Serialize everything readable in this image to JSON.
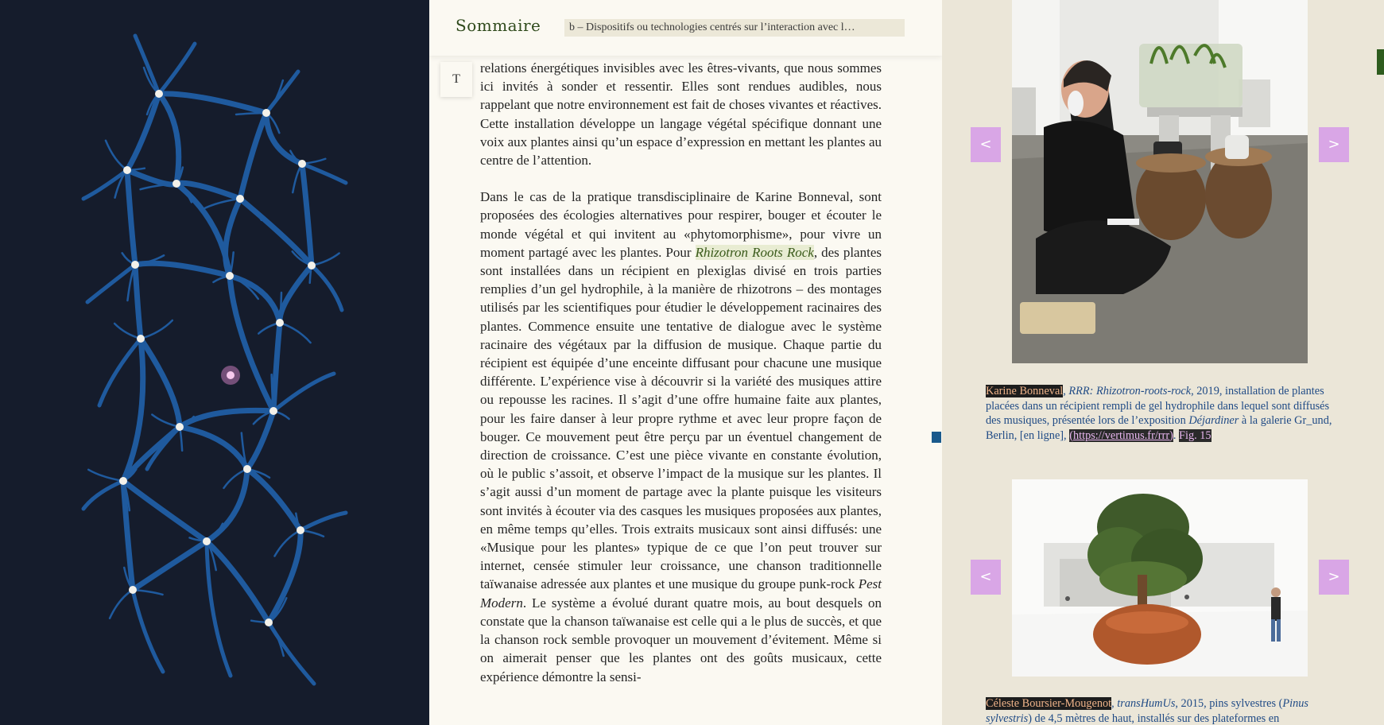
{
  "header": {
    "sommaire": "Sommaire",
    "section": "b – Dispositifs ou technologies centrés sur l’interaction avec l…",
    "text_toggle": "T"
  },
  "article": {
    "p1": "relations énergétiques invisibles avec les êtres-vivants, que nous sommes ici invités à sonder et ressentir. Elles sont rendues audibles, nous rappelant que notre environnement est fait de choses vivantes et réactives. Cette installation développe un langage végétal spécifique donnant une voix aux plantes ainsi qu’un espace d’expression en mettant les plantes au centre de l’attention.",
    "p2_a": "Dans le cas de la pratique transdisciplinaire de Karine Bonneval, sont proposées des écologies alternatives pour respirer, bouger et écouter le monde végétal et qui invitent au «phytomorphisme», pour vivre un moment partagé avec les plantes. Pour ",
    "p2_work": "Rhizotron Roots Rock",
    "p2_b": ", des plantes sont installées dans un récipient en plexiglas divisé en trois parties remplies d’un gel hydrophile, à la manière de rhizotrons – des montages utilisés par les scientifiques pour étudier le développement racinaires des plantes. Commence ensuite une tentative de dialogue avec le système racinaire des végétaux par la diffusion de musique. Chaque partie du récipient est équipée d’une enceinte diffusant pour chacune une musique différente. L’expérience vise à découvrir si la variété des musiques attire ou repousse les racines. Il s’agit d’une offre humaine faite aux plantes, pour les faire danser à leur propre rythme et avec leur propre façon de bouger. Ce mouvement peut être perçu par un éventuel changement de direction de croissance. C’est une pièce vivante en constante évolution, où le public s’assoit, et observe l’impact de la musique sur les plantes. Il s’agit aussi d’un moment de partage avec la plante puisque les visiteurs sont invités à écouter via des casques les musiques proposées aux plantes, en même temps qu’elles. Trois extraits musicaux sont ainsi diffusés: une «Musique pour les plantes» typique de ce que l’on peut trouver sur internet, censée stimuler leur croissance, une chanson traditionnelle taïwanaise adressée aux plantes et une musique du groupe punk-rock ",
    "p2_band": "Pest Modern",
    "p2_c": ". Le système a évolué durant quatre mois, au bout desquels on constate que la chanson taïwanaise est celle qui a le plus de succès, et que la chanson rock semble provoquer un mouvement d’évitement. Même si on aimerait penser que les plantes ont des goûts musicaux, cette expérience démontre la sensi-"
  },
  "gallery": {
    "prev": "<",
    "next": ">",
    "fig15": {
      "author": "Karine Bonneval",
      "sep": ", ",
      "title": "RRR: Rhizotron-roots-rock",
      "rest_a": ", 2019, installation de plantes placées dans un récipient rempli de gel hydrophile dans lequel sont diffusés des musiques, présentée lors de l’exposition ",
      "expo": "Déjardiner",
      "rest_b": " à la galerie Gr_und, Berlin, [en ligne],",
      "link": "(https://vertimus.fr/rrr)",
      "fig": "Fig. 15"
    },
    "fig16": {
      "author": "Céleste Boursier-Mougenot",
      "sep": ", ",
      "title": "transHumUs",
      "rest_a": ", 2015, pins sylvestres (",
      "latin": "Pinus sylvestris",
      "rest_b": ") de 4,5 mètres de haut, installés sur des plateformes en"
    }
  }
}
